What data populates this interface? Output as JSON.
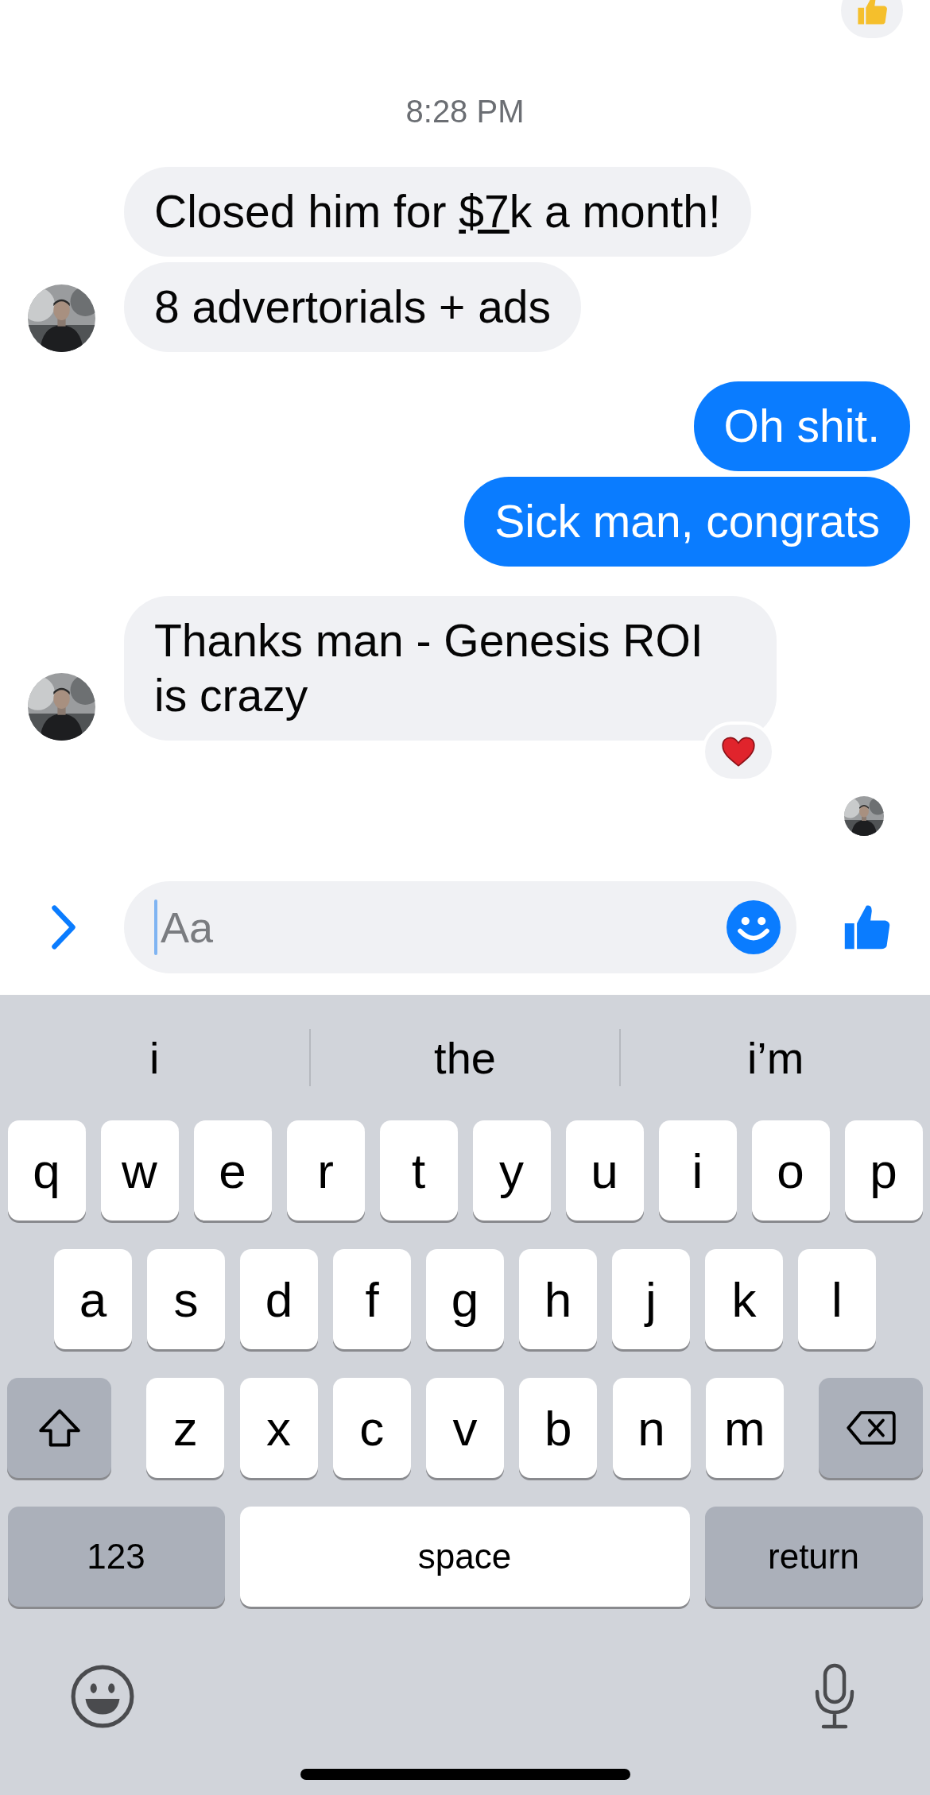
{
  "top_reaction": {
    "kind": "thumbs"
  },
  "timestamp": "8:28 PM",
  "messages": [
    {
      "kind": "incoming",
      "avatar": false,
      "segments": [
        {
          "text": "Closed him for ",
          "link": false
        },
        {
          "text": "$7",
          "link": true
        },
        {
          "text": "k a month!",
          "link": false
        }
      ]
    },
    {
      "kind": "incoming",
      "avatar": true,
      "text": "8 advertorials + ads"
    },
    {
      "kind": "outgoing",
      "text": "Oh shit."
    },
    {
      "kind": "outgoing",
      "text": "Sick man, congrats"
    },
    {
      "kind": "incoming",
      "avatar": true,
      "text": "Thanks man - Genesis ROI is crazy",
      "reaction": {
        "kind": "heart"
      }
    }
  ],
  "read_receipt": true,
  "composer": {
    "placeholder": "Aa"
  },
  "keyboard": {
    "suggestions": [
      "i",
      "the",
      "i’m"
    ],
    "rows": [
      {
        "keys": [
          {
            "kind": "letter",
            "label": "q"
          },
          {
            "kind": "letter",
            "label": "w"
          },
          {
            "kind": "letter",
            "label": "e"
          },
          {
            "kind": "letter",
            "label": "r"
          },
          {
            "kind": "letter",
            "label": "t"
          },
          {
            "kind": "letter",
            "label": "y"
          },
          {
            "kind": "letter",
            "label": "u"
          },
          {
            "kind": "letter",
            "label": "i"
          },
          {
            "kind": "letter",
            "label": "o"
          },
          {
            "kind": "letter",
            "label": "p"
          }
        ]
      },
      {
        "keys": [
          {
            "kind": "letter",
            "label": "a"
          },
          {
            "kind": "letter",
            "label": "s"
          },
          {
            "kind": "letter",
            "label": "d"
          },
          {
            "kind": "letter",
            "label": "f"
          },
          {
            "kind": "letter",
            "label": "g"
          },
          {
            "kind": "letter",
            "label": "h"
          },
          {
            "kind": "letter",
            "label": "j"
          },
          {
            "kind": "letter",
            "label": "k"
          },
          {
            "kind": "letter",
            "label": "l"
          }
        ]
      },
      {
        "keys": [
          {
            "kind": "shift"
          },
          {
            "kind": "letter",
            "label": "z"
          },
          {
            "kind": "letter",
            "label": "x"
          },
          {
            "kind": "letter",
            "label": "c"
          },
          {
            "kind": "letter",
            "label": "v"
          },
          {
            "kind": "letter",
            "label": "b"
          },
          {
            "kind": "letter",
            "label": "n"
          },
          {
            "kind": "letter",
            "label": "m"
          },
          {
            "kind": "delete"
          }
        ]
      },
      {
        "keys": [
          {
            "kind": "mode",
            "label": "123"
          },
          {
            "kind": "space",
            "label": "space"
          },
          {
            "kind": "return",
            "label": "return"
          }
        ]
      }
    ]
  }
}
